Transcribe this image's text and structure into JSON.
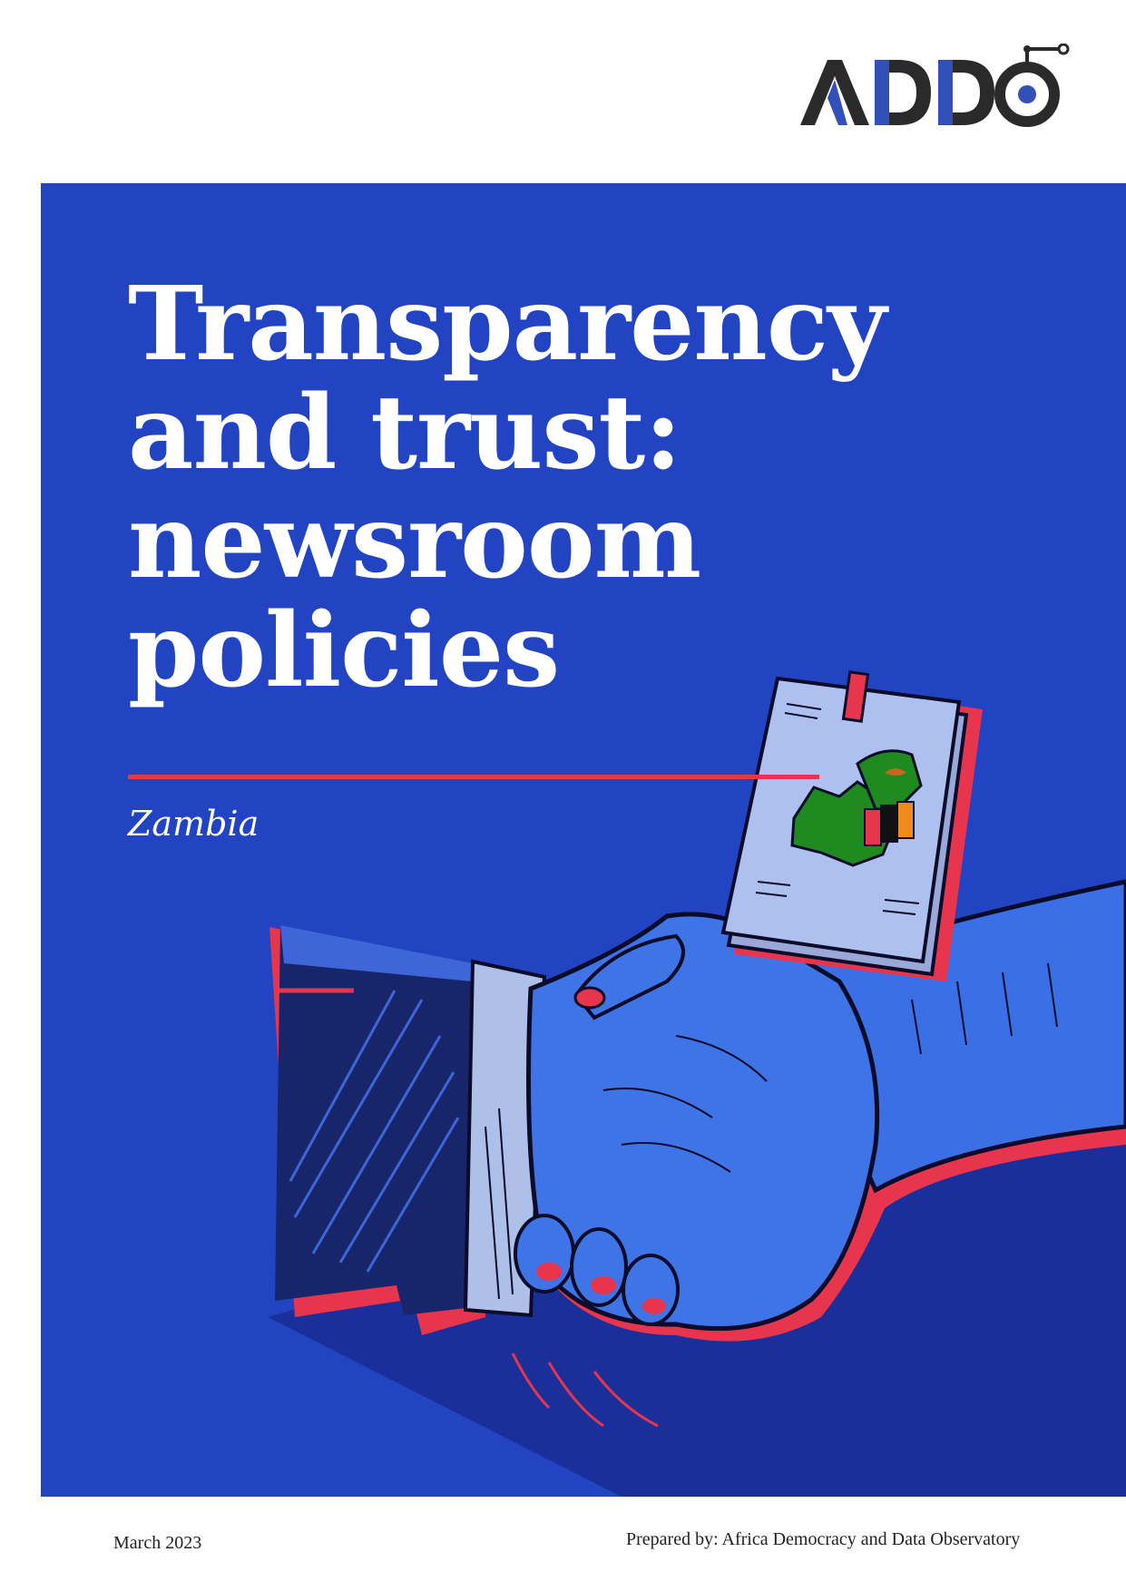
{
  "brand": {
    "logo_text": "ADDO",
    "accent": "#2244c3",
    "dark": "#2a2a2a"
  },
  "cover": {
    "background": "#2244c3",
    "title_lines": [
      "Transparency",
      "and trust:",
      "newsroom",
      "policies"
    ],
    "subtitle": "Zambia",
    "rule_color": "#e8354e",
    "illustration": "handshake-with-zambia-notebook"
  },
  "footer": {
    "date": "March 2023",
    "prepared_by": "Prepared by: Africa Democracy and Data Observatory"
  }
}
